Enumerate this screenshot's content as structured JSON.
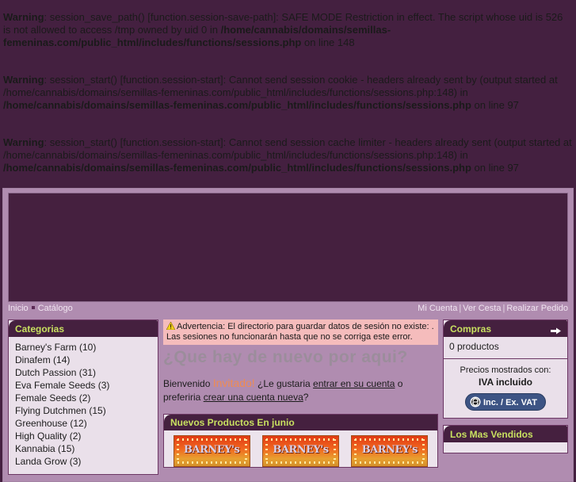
{
  "warnings": [
    {
      "label": "Warning",
      "text_1": ": session_save_path() [function.session-save-path]: SAFE MODE Restriction in effect. The script whose uid is 526 is not allowed to access /tmp owned by uid 0 in ",
      "path": "/home/cannabis/domains/semillas-femeninas.com/public_html/includes/functions/sessions.php",
      "text_2": " on line 148"
    },
    {
      "label": "Warning",
      "text_1": ": session_start() [function.session-start]: Cannot send session cookie - headers already sent by (output started at /home/cannabis/domains/semillas-femeninas.com/public_html/includes/functions/sessions.php:148) in ",
      "path": "/home/cannabis/domains/semillas-femeninas.com/public_html/includes/functions/sessions.php",
      "text_2": " on line 97"
    },
    {
      "label": "Warning",
      "text_1": ": session_start() [function.session-start]: Cannot send session cache limiter - headers already sent (output started at /home/cannabis/domains/semillas-femeninas.com/public_html/includes/functions/sessions.php:148) in ",
      "path": "/home/cannabis/domains/semillas-femeninas.com/public_html/includes/functions/sessions.php",
      "text_2": " on line 97"
    }
  ],
  "nav": {
    "breadcrumb": [
      {
        "label": "Inicio"
      },
      {
        "label": "Catálogo"
      }
    ],
    "links": [
      {
        "label": "Mi Cuenta"
      },
      {
        "label": "Ver Cesta"
      },
      {
        "label": "Realizar Pedido"
      }
    ],
    "separator": "|"
  },
  "sidebar_left": {
    "categories": {
      "title": "Categorias",
      "items": [
        {
          "label": "Barney's Farm (10)"
        },
        {
          "label": "Dinafem (14)"
        },
        {
          "label": "Dutch Passion (31)"
        },
        {
          "label": "Eva Female Seeds (3)"
        },
        {
          "label": "Female Seeds (2)"
        },
        {
          "label": "Flying Dutchmen (15)"
        },
        {
          "label": "Greenhouse (12)"
        },
        {
          "label": "High Quality (2)"
        },
        {
          "label": "Kannabia (15)"
        },
        {
          "label": "Landa Grow (3)"
        }
      ]
    }
  },
  "main": {
    "alert": "Advertencia: El directorio para guardar datos de sesión no existe: . Las sesiones no funcionarán hasta que no se corriga este error.",
    "title": "¿Que hay de nuevo por aqui?",
    "welcome": {
      "pre": "Bienvenido ",
      "guest": "Invitado!",
      "mid": " ¿Le gustaria ",
      "link_login": "entrar en su cuenta",
      "mid2": " o preferiria ",
      "link_register": "crear una cuenta nueva",
      "end": "?"
    },
    "new_products": {
      "title": "Nuevos Productos En junio",
      "items": [
        {
          "brand": "BARNEY's"
        },
        {
          "brand": "BARNEY's"
        },
        {
          "brand": "BARNEY's"
        }
      ]
    }
  },
  "sidebar_right": {
    "cart": {
      "title": "Compras",
      "arrow_icon": "arrow-right-icon",
      "count": "0 productos"
    },
    "vat": {
      "line1": "Precios mostrados con:",
      "line2": "IVA incluido",
      "button": "Inc. / Ex. VAT",
      "button_icon": "swap-circle-icon"
    },
    "bestsellers": {
      "title": "Los Mas Vendidos"
    }
  },
  "colors": {
    "page_bg": "#442040",
    "panel_bg": "#b08cb0",
    "box_head": "#45203f",
    "box_head_text": "#c8e060",
    "box_body": "#eae0ea",
    "alert_bg": "#f5bcbc",
    "guest": "#ef8b52",
    "vat_button": "#3d5484"
  }
}
